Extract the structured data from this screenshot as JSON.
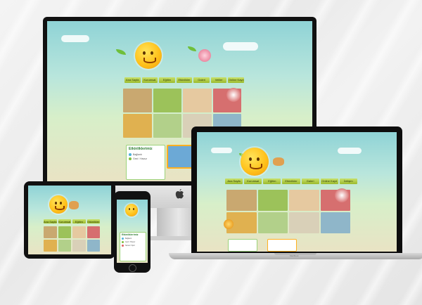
{
  "site": {
    "nav": [
      "Ana Sayfa",
      "Kurumsal",
      "Eğitim",
      "Etkinlikler",
      "Galeri",
      "Veliler",
      "Online Kayıt",
      "İletişim"
    ],
    "panel_title": "Etkinliklerimiz",
    "panel_items": [
      "Bağlantı",
      "Gezi / Havuz",
      "Sanat / Spor"
    ]
  },
  "devices": {
    "imac_logo": "apple-logo",
    "macbook_label": "MacBook"
  },
  "colors": {
    "nav_green": "#9cbb2d",
    "sun": "#ffc21c",
    "sky": "#8fd3d6"
  }
}
